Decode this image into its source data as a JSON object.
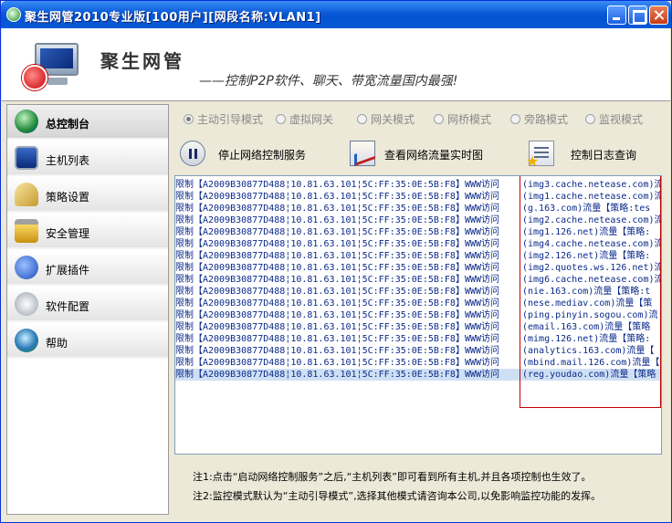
{
  "window": {
    "title": "聚生网管2010专业版[100用户][网段名称:VLAN1]"
  },
  "banner": {
    "brand": "聚生网管",
    "slogan": "——控制P2P软件、聊天、带宽流量国内最强!"
  },
  "sidebar": {
    "items": [
      {
        "label": "总控制台",
        "icon": "globe-icon",
        "active": true
      },
      {
        "label": "主机列表",
        "icon": "monitor-icon",
        "active": false
      },
      {
        "label": "策略设置",
        "icon": "wizard-icon",
        "active": false
      },
      {
        "label": "安全管理",
        "icon": "lock-icon",
        "active": false
      },
      {
        "label": "扩展插件",
        "icon": "plugin-icon",
        "active": false
      },
      {
        "label": "软件配置",
        "icon": "config-icon",
        "active": false
      },
      {
        "label": "帮助",
        "icon": "help-icon",
        "active": false
      }
    ]
  },
  "modes": [
    {
      "label": "主动引导模式",
      "checked": true
    },
    {
      "label": "虚拟网关",
      "checked": false
    },
    {
      "label": "网关模式",
      "checked": false
    },
    {
      "label": "网桥模式",
      "checked": false
    },
    {
      "label": "旁路模式",
      "checked": false
    },
    {
      "label": "监视模式",
      "checked": false
    }
  ],
  "toolbar": {
    "stop_label": "停止网络控制服务",
    "traffic_label": "查看网络流量实时图",
    "log_label": "控制日志查询"
  },
  "log": {
    "prefix": "限制【A2009B30877D488¦10.81.63.101¦5C:FF:35:0E:5B:F8】WWW访问",
    "details": [
      "(img3.cache.netease.com)流",
      "(img1.cache.netease.com)流",
      "(g.163.com)流量【策略:tes",
      "(img2.cache.netease.com)流",
      "(img1.126.net)流量【策略:",
      "(img4.cache.netease.com)流",
      "(img2.126.net)流量【策略:",
      "(img2.quotes.ws.126.net)流",
      "(img6.cache.netease.com)流",
      "(nie.163.com)流量【策略:t",
      "(nese.mediav.com)流量【策",
      "(ping.pinyin.sogou.com)流",
      "(email.163.com)流量【策略",
      "(mimg.126.net)流量【策略:",
      "(analytics.163.com)流量【",
      "(mbind.mail.126.com)流量【",
      "(reg.youdao.com)流量【策略"
    ],
    "selected_index": 16
  },
  "notes": {
    "line1": "注1:点击“启动网络控制服务”之后,“主机列表”即可看到所有主机,并且各项控制也生效了。",
    "line2": "注2:监控模式默认为“主动引导模式”,选择其他模式请咨询本公司,以免影响监控功能的发挥。"
  },
  "colors": {
    "titlebar": "#0a5ad8",
    "log_text": "#0b2a8a",
    "highlight_border": "#c00000",
    "selected_row": "#cfe0f4"
  }
}
